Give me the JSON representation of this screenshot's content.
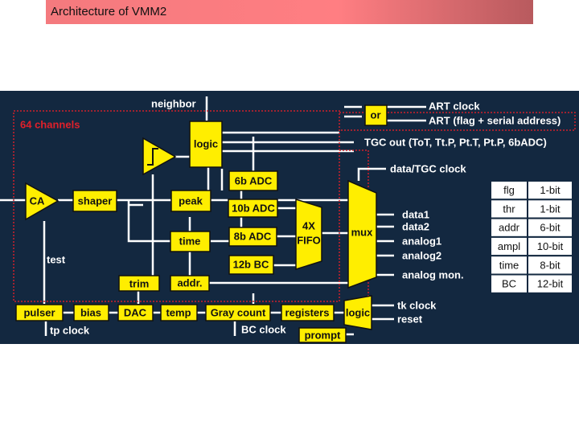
{
  "slide": {
    "title": "Architecture of VMM2"
  },
  "diagram": {
    "channels": "64 channels",
    "neighbor": "neighbor",
    "blocks": {
      "logic": "logic",
      "ca": "CA",
      "shaper": "shaper",
      "peak": "peak",
      "time": "time",
      "addr": "addr.",
      "trim": "trim",
      "adc6": "6b ADC",
      "adc10": "10b ADC",
      "adc8": "8b ADC",
      "bc12": "12b BC",
      "fifo1": "4X",
      "fifo2": "FIFO",
      "mux": "mux",
      "or": "or",
      "logic2": "logic",
      "prompt": "prompt"
    },
    "bottom": [
      "pulser",
      "bias",
      "DAC",
      "temp",
      "Gray count",
      "registers"
    ],
    "labels": {
      "test": "test",
      "tp_clock": "tp clock",
      "bc_clock": "BC clock",
      "art_clock": "ART clock",
      "art": "ART (flag + serial address)",
      "tgc_out": "TGC out (ToT, Tt.P, Pt.T, Pt.P, 6bADC)",
      "data_tgc_clock": "data/TGC clock",
      "data1": "data1",
      "data2": "data2",
      "analog1": "analog1",
      "analog2": "analog2",
      "analog_mon": "analog mon.",
      "tk_clock": "tk clock",
      "reset": "reset"
    },
    "bits": [
      [
        "flg",
        "1-bit"
      ],
      [
        "thr",
        "1-bit"
      ],
      [
        "addr",
        "6-bit"
      ],
      [
        "ampl",
        "10-bit"
      ],
      [
        "time",
        "8-bit"
      ],
      [
        "BC",
        "12-bit"
      ]
    ]
  }
}
